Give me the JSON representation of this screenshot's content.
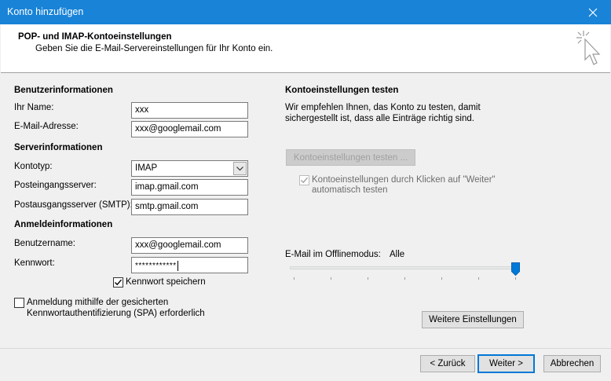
{
  "window": {
    "title": "Konto hinzufügen"
  },
  "header": {
    "title": "POP- und IMAP-Kontoeinstellungen",
    "subtitle": "Geben Sie die E-Mail-Servereinstellungen für Ihr Konto ein."
  },
  "user_info": {
    "section": "Benutzerinformationen",
    "name_label": "Ihr Name:",
    "name_value": "xxx",
    "email_label": "E-Mail-Adresse:",
    "email_value": "xxx@googlemail.com"
  },
  "server_info": {
    "section": "Serverinformationen",
    "account_type_label": "Kontotyp:",
    "account_type_value": "IMAP",
    "incoming_label": "Posteingangsserver:",
    "incoming_value": "imap.gmail.com",
    "outgoing_label": "Postausgangsserver (SMTP):",
    "outgoing_value": "smtp.gmail.com"
  },
  "login_info": {
    "section": "Anmeldeinformationen",
    "username_label": "Benutzername:",
    "username_value": "xxx@googlemail.com",
    "password_label": "Kennwort:",
    "password_value": "************",
    "remember_password_label": "Kennwort speichern",
    "remember_password_checked": true,
    "spa_label_line1": "Anmeldung mithilfe der gesicherten",
    "spa_label_line2": "Kennwortauthentifizierung (SPA) erforderlich",
    "spa_checked": false
  },
  "test_settings": {
    "section": "Kontoeinstellungen testen",
    "desc_line1": "Wir empfehlen Ihnen, das Konto zu testen, damit",
    "desc_line2": "sichergestellt ist, dass alle Einträge richtig sind.",
    "test_button": "Kontoeinstellungen testen ...",
    "auto_test_line1": "Kontoeinstellungen durch Klicken auf \"Weiter\"",
    "auto_test_line2": "automatisch testen",
    "auto_test_checked": true
  },
  "offline": {
    "label": "E-Mail im Offlinemodus:",
    "value": "Alle",
    "slider_fraction": 1.0
  },
  "more_settings_button": "Weitere Einstellungen",
  "footer": {
    "back": "< Zurück",
    "next": "Weiter >",
    "cancel": "Abbrechen"
  },
  "colors": {
    "titlebar": "#1883d7",
    "accent": "#0078d7"
  }
}
